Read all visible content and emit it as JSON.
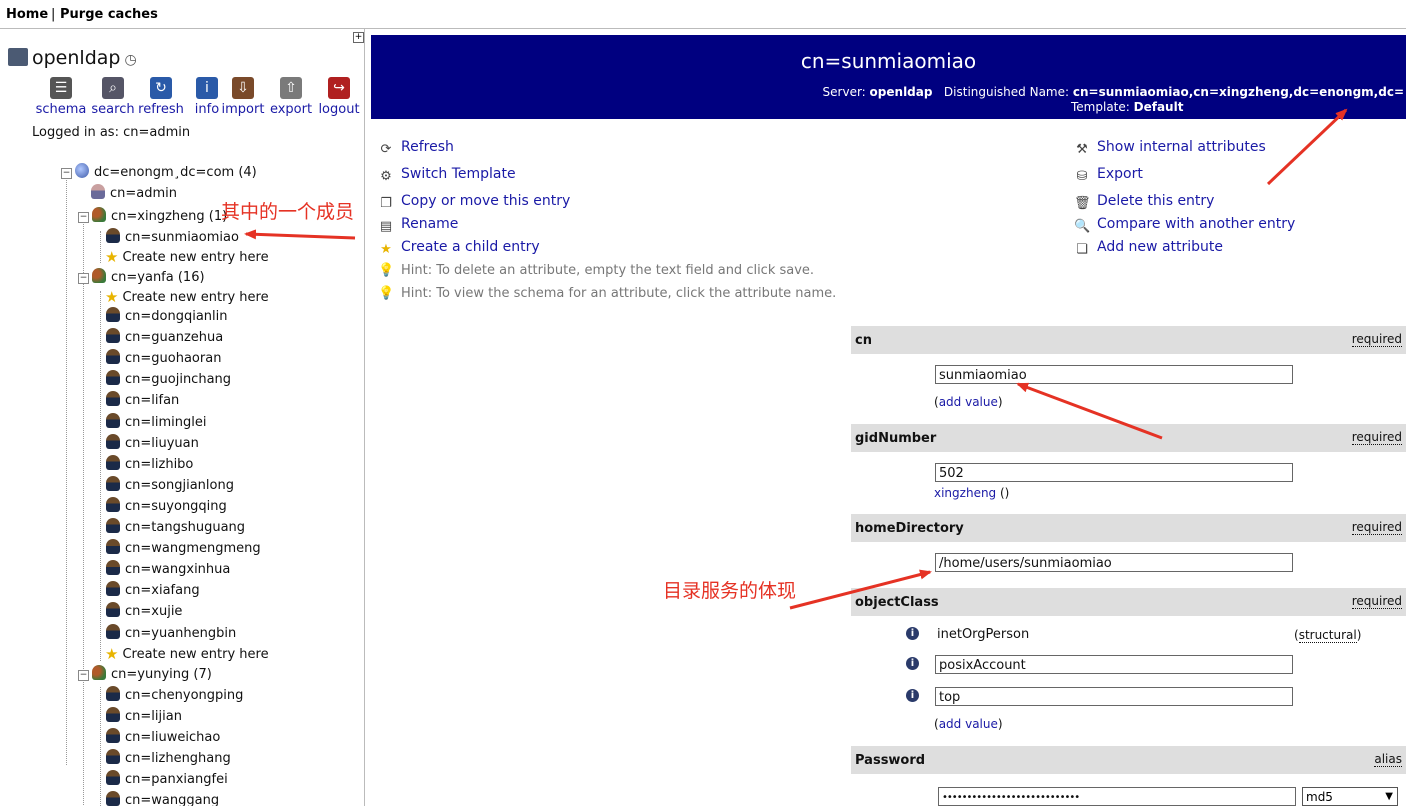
{
  "topbar": {
    "home": "Home",
    "sep": "|",
    "purge": "Purge caches"
  },
  "sidebar": {
    "expand_icon": "+",
    "server_name": "openldap",
    "toolbar": [
      {
        "label": "schema",
        "icon": "schema-icon"
      },
      {
        "label": "search",
        "icon": "search-icon"
      },
      {
        "label": "refresh",
        "icon": "refresh-icon"
      },
      {
        "label": "info",
        "icon": "info-icon"
      },
      {
        "label": "import",
        "icon": "import-icon"
      },
      {
        "label": "export",
        "icon": "export-icon"
      },
      {
        "label": "logout",
        "icon": "logout-icon"
      }
    ],
    "logged_in": "Logged in as: cn=admin",
    "root": "dc=enongm¸dc=com (4)",
    "admin": "cn=admin",
    "group_xingzheng": "cn=xingzheng (1)",
    "xingzheng_members": [
      "cn=sunmiaomiao"
    ],
    "create_new": "Create new entry here",
    "group_yanfa": "cn=yanfa (16)",
    "yanfa_members": [
      "cn=dongqianlin",
      "cn=guanzehua",
      "cn=guohaoran",
      "cn=guojinchang",
      "cn=lifan",
      "cn=liminglei",
      "cn=liuyuan",
      "cn=lizhibo",
      "cn=songjianlong",
      "cn=suyongqing",
      "cn=tangshuguang",
      "cn=wangmengmeng",
      "cn=wangxinhua",
      "cn=xiafang",
      "cn=xujie",
      "cn=yuanhengbin"
    ],
    "group_yunying": "cn=yunying (7)",
    "yunying_members": [
      "cn=chenyongping",
      "cn=lijian",
      "cn=liuweichao",
      "cn=lizhenghang",
      "cn=panxiangfei",
      "cn=wanggang"
    ]
  },
  "header": {
    "title": "cn=sunmiaomiao",
    "server_label": "Server:",
    "server_value": "openldap",
    "dn_label": "Distinguished Name:",
    "dn_value": "cn=sunmiaomiao,cn=xingzheng,dc=enongm,dc=",
    "template_label": "Template:",
    "template_value": "Default"
  },
  "actions_left": [
    "Refresh",
    "Switch Template",
    "Copy or move this entry",
    "Rename",
    "Create a child entry"
  ],
  "hints": [
    "Hint: To delete an attribute, empty the text field and click save.",
    "Hint: To view the schema for an attribute, click the attribute name."
  ],
  "actions_right": [
    "Show internal attributes",
    "Export",
    "Delete this entry",
    "Compare with another entry",
    "Add new attribute"
  ],
  "attributes": {
    "cn": {
      "name": "cn",
      "flag": "required",
      "value": "sunmiaomiao",
      "add": "add value"
    },
    "gidNumber": {
      "name": "gidNumber",
      "flag": "required",
      "value": "502",
      "lookup": "xingzheng",
      "lookup_suffix": "()"
    },
    "homeDirectory": {
      "name": "homeDirectory",
      "flag": "required",
      "value": "/home/users/sunmiaomiao"
    },
    "objectClass": {
      "name": "objectClass",
      "flag": "required",
      "structural_value": "inetOrgPerson",
      "structural_tag": "structural",
      "values": [
        "posixAccount",
        "top"
      ],
      "add": "add value"
    },
    "password": {
      "name": "Password",
      "flag": "alias",
      "value": "••••••••••••••••••••••••••••",
      "hash": "md5"
    }
  },
  "annotations": {
    "member_note": "其中的一个成员",
    "directory_note": "目录服务的体现"
  },
  "colors": {
    "header_bg": "#000080",
    "link": "#1a1aa6",
    "annotation": "#e53224",
    "attr_head_bg": "#dedede"
  }
}
